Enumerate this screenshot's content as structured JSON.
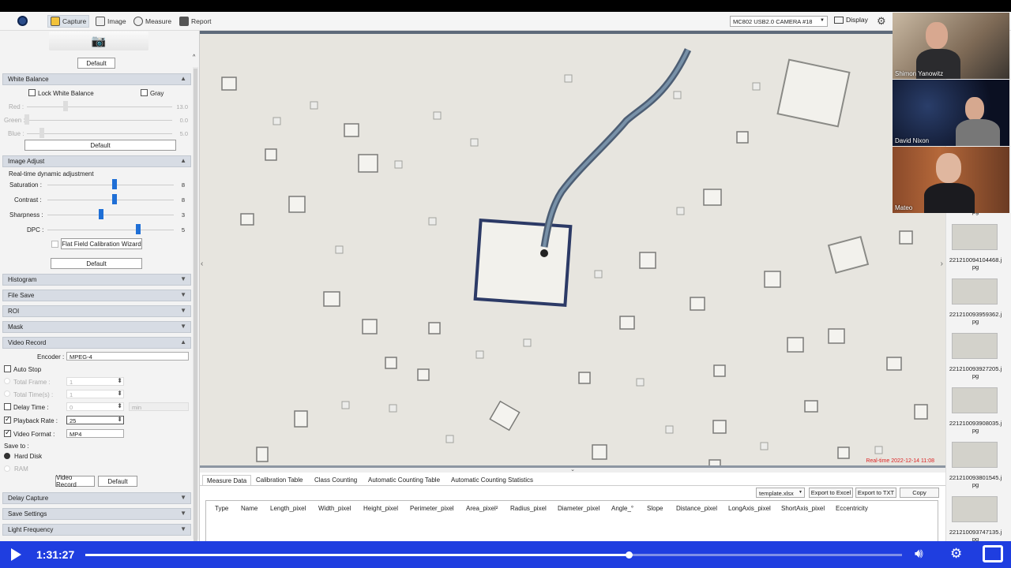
{
  "topbar": {
    "tabs": [
      "Capture",
      "Image",
      "Measure",
      "Report"
    ],
    "camera": "MC802 USB2.0 CAMERA #18",
    "display": "Display"
  },
  "left": {
    "default_top": "Default",
    "white_balance": {
      "title": "White Balance",
      "lock": "Lock White Balance",
      "gray": "Gray",
      "red_label": "Red :",
      "red_val": "13.0",
      "green_label": "Green :",
      "green_val": "0.0",
      "blue_label": "Blue :",
      "blue_val": "5.0",
      "default": "Default"
    },
    "image_adjust": {
      "title": "Image Adjust",
      "subtitle": "Real-time dynamic adjustment",
      "saturation_label": "Saturation :",
      "saturation_val": "8",
      "contrast_label": "Contrast :",
      "contrast_val": "8",
      "sharpness_label": "Sharpness :",
      "sharpness_val": "3",
      "dpc_label": "DPC :",
      "dpc_val": "5",
      "flat_field": "Flat Field Calibration Wizard",
      "default": "Default"
    },
    "sections": [
      "Histogram",
      "File Save",
      "ROI",
      "Mask"
    ],
    "video_record": {
      "title": "Video Record",
      "encoder_label": "Encoder :",
      "encoder_val": "MPEG-4",
      "auto_stop": "Auto Stop",
      "total_frame": "Total Frame :",
      "total_frame_val": "1",
      "total_time": "Total Time(s) :",
      "total_time_val": "1",
      "delay_time": "Delay Time :",
      "delay_time_val": "0",
      "delay_unit": "min",
      "playback_rate": "Playback Rate :",
      "playback_rate_val": "25",
      "video_format": "Video Format :",
      "video_format_val": "MP4",
      "save_to": "Save to :",
      "hard_disk": "Hard Disk",
      "ram": "RAM",
      "video_record_btn": "Video Record",
      "default": "Default"
    },
    "bottom_sections": [
      "Delay Capture",
      "Save Settings",
      "Light Frequency"
    ]
  },
  "viewer": {
    "timestamp": "Real-time 2022-12-14 11:08"
  },
  "lower": {
    "tabs": [
      "Measure Data",
      "Calibration Table",
      "Class Counting",
      "Automatic Counting Table",
      "Automatic Counting Statistics"
    ],
    "template": "template.xlsx",
    "export_excel": "Export to Excel",
    "export_txt": "Export to TXT",
    "copy": "Copy",
    "columns": [
      "Type",
      "Name",
      "Length_pixel",
      "Width_pixel",
      "Height_pixel",
      "Perimeter_pixel",
      "Area_pixel²",
      "Radius_pixel",
      "Diameter_pixel",
      "Angle_°",
      "Slope",
      "Distance_pixel",
      "LongAxis_pixel",
      "ShortAxis_pixel",
      "Eccentricity"
    ]
  },
  "thumbnails": [
    "pg",
    "221210094104468.jpg",
    "221210093959362.jpg",
    "221210093927205.jpg",
    "221210093908035.jpg",
    "221210093801545.jpg",
    "221210093747135.jpg"
  ],
  "participants": [
    "Shimon Yanowitz",
    "David Nixon",
    "Mateo"
  ],
  "player": {
    "time": "1:31:27",
    "progress": 0.665
  }
}
